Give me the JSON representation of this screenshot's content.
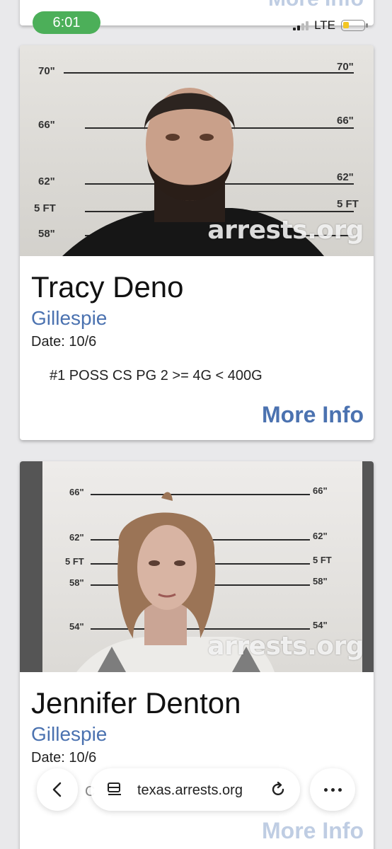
{
  "status_bar": {
    "time": "6:01",
    "network": "LTE"
  },
  "top_card": {
    "more_label": "More Info"
  },
  "cards": [
    {
      "name": "Tracy Deno",
      "county": "Gillespie",
      "date": "Date: 10/6",
      "charge": "#1 POSS CS PG 2 >= 4G < 400G",
      "more_label": "More Info",
      "watermark": "arrests.org",
      "height_labels": [
        "70\"",
        "66\"",
        "62\"",
        "5 FT",
        "58\""
      ]
    },
    {
      "name": "Jennifer Denton",
      "county": "Gillespie",
      "date": "Date: 10/6",
      "charge": "C",
      "more_label": "More Info",
      "watermark": "arrests.org",
      "height_labels": [
        "66\"",
        "62\"",
        "5 FT",
        "58\"",
        "54\""
      ]
    }
  ],
  "browser": {
    "url": "texas.arrests.org"
  }
}
